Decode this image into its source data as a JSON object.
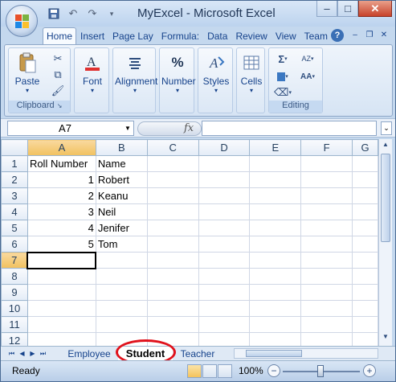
{
  "window": {
    "title": "MyExcel - Microsoft Excel",
    "controls": {
      "minimize": "–",
      "maximize": "□",
      "close": "✕"
    }
  },
  "quick_access": [
    "save-icon",
    "undo-icon",
    "redo-icon",
    "customize-icon"
  ],
  "ribbon": {
    "tabs": [
      {
        "label": "Home",
        "active": true
      },
      {
        "label": "Insert"
      },
      {
        "label": "Page Lay"
      },
      {
        "label": "Formula:"
      },
      {
        "label": "Data"
      },
      {
        "label": "Review"
      },
      {
        "label": "View"
      },
      {
        "label": "Team"
      }
    ],
    "groups": {
      "clipboard": {
        "label": "Clipboard",
        "paste": "Paste"
      },
      "font": {
        "label": "Font"
      },
      "alignment": {
        "label": "Alignment"
      },
      "number": {
        "label": "Number",
        "icon_text": "%"
      },
      "styles": {
        "label": "Styles"
      },
      "cells": {
        "label": "Cells"
      },
      "editing": {
        "label": "Editing",
        "sum_icon": "Σ",
        "sort_icon": "AZ",
        "find_icon": "AA"
      }
    }
  },
  "formula_bar": {
    "name_box": "A7",
    "fx": "fx",
    "formula": ""
  },
  "grid": {
    "columns": [
      "A",
      "B",
      "C",
      "D",
      "E",
      "F",
      "G"
    ],
    "rows": [
      {
        "n": "1",
        "a": "Roll Number",
        "b": "Name"
      },
      {
        "n": "2",
        "a": "1",
        "b": "Robert"
      },
      {
        "n": "3",
        "a": "2",
        "b": "Keanu"
      },
      {
        "n": "4",
        "a": "3",
        "b": "Neil"
      },
      {
        "n": "5",
        "a": "4",
        "b": "Jenifer"
      },
      {
        "n": "6",
        "a": "5",
        "b": "Tom"
      },
      {
        "n": "7",
        "a": "",
        "b": ""
      },
      {
        "n": "8",
        "a": "",
        "b": ""
      },
      {
        "n": "9",
        "a": "",
        "b": ""
      },
      {
        "n": "10",
        "a": "",
        "b": ""
      },
      {
        "n": "11",
        "a": "",
        "b": ""
      },
      {
        "n": "12",
        "a": "",
        "b": ""
      }
    ],
    "active_cell": "A7"
  },
  "sheets": [
    {
      "label": "Employee"
    },
    {
      "label": "Student",
      "active": true,
      "highlighted": true
    },
    {
      "label": "Teacher"
    }
  ],
  "status": {
    "text": "Ready",
    "zoom": "100%",
    "zoom_level": 1.0
  },
  "colors": {
    "highlight_circle": "#e0121c",
    "selected_header": "#f1c15f",
    "ribbon_text": "#15428b"
  }
}
